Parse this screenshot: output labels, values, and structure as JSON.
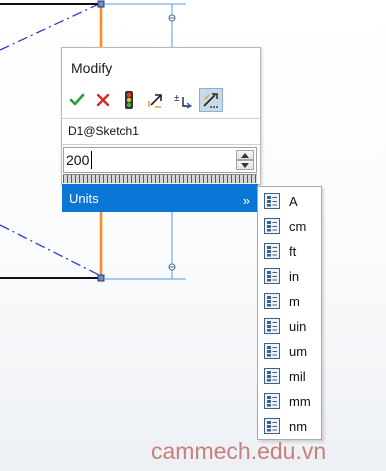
{
  "dialog": {
    "title": "Modify",
    "toolbar": [
      {
        "name": "ok-check-icon"
      },
      {
        "name": "cancel-x-icon"
      },
      {
        "name": "rebuild-traffic-light-icon"
      },
      {
        "name": "reverse-direction-icon"
      },
      {
        "name": "mark-dimension-icon"
      },
      {
        "name": "drive-dimension-icon"
      }
    ],
    "dimension_name": "D1@Sketch1",
    "value": "200"
  },
  "units_menu": {
    "label": "Units",
    "arrow": "»",
    "items": [
      "A",
      "cm",
      "ft",
      "in",
      "m",
      "uin",
      "um",
      "mil",
      "mm",
      "nm"
    ]
  },
  "watermark": "cammech.edu.vn",
  "colors": {
    "accent": "#0a77d6",
    "sketch_line": "#ff8a1c",
    "construction_line": "#2b39c7",
    "dimension_line": "#5b9be0"
  }
}
